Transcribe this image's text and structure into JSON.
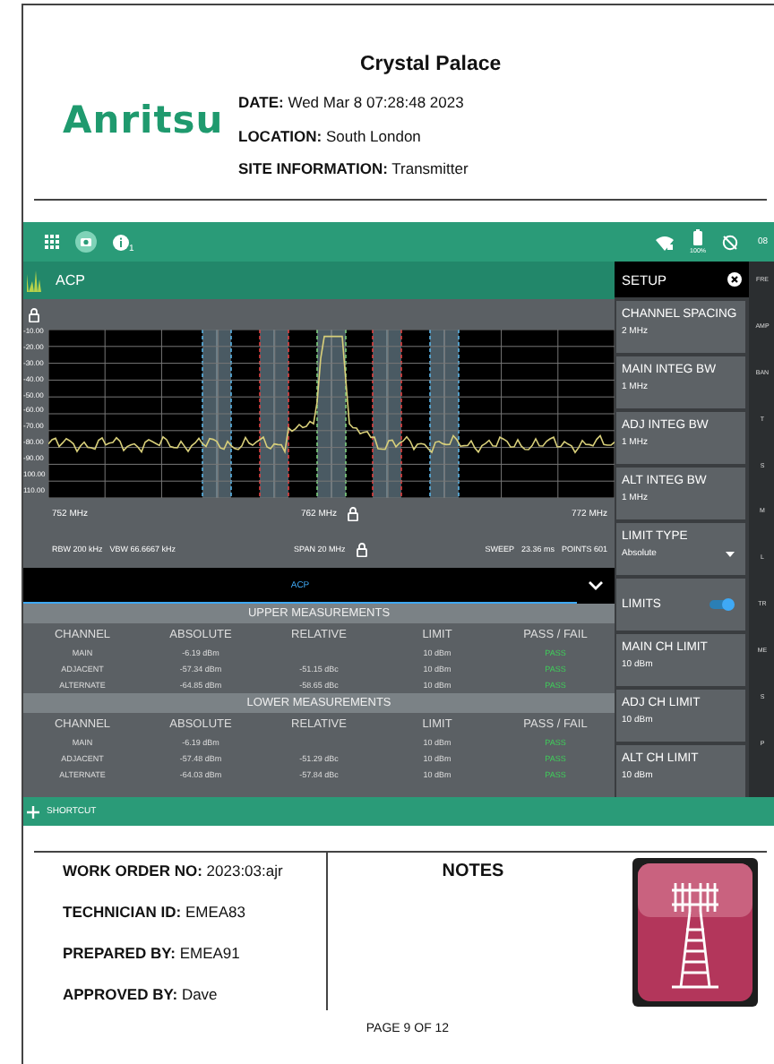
{
  "header": {
    "logo": "Anritsu",
    "title": "Crystal Palace",
    "fields": [
      "**DATE:** Wed Mar 8 07:28:48 2023",
      "**LOCATION:** South London",
      "**SITE INFORMATION:** Transmitter"
    ]
  },
  "instrument": {
    "status_bar": {
      "notification_count": "1",
      "battery": "100%",
      "clock": "08"
    },
    "app_bar": {
      "title": "ACP"
    },
    "plot": {
      "y_ticks": [
        "-10.00",
        "-20.00",
        "-30.00",
        "-40.00",
        "-50.00",
        "-60.00",
        "-70.00",
        "-80.00",
        "-90.00",
        "100.00",
        "110.00"
      ],
      "x_labels": [
        "752 MHz",
        "762 MHz",
        "772 MHz"
      ],
      "settings_left": [
        "RBW 200 kHz",
        "VBW 66.6667 kHz"
      ],
      "span": "SPAN 20 MHz",
      "sweep": "SWEEP",
      "sweep_time": "23.36 ms",
      "points": "POINTS 601"
    },
    "view_tab": "ACP",
    "sections": [
      {
        "title": "UPPER MEASUREMENTS",
        "columns": [
          "CHANNEL",
          "ABSOLUTE",
          "RELATIVE",
          "LIMIT",
          "PASS / FAIL"
        ],
        "rows": [
          [
            "MAIN",
            "-6.19 dBm",
            "",
            "10 dBm",
            "PASS"
          ],
          [
            "ADJACENT",
            "-57.34 dBm",
            "-51.15 dBc",
            "10 dBm",
            "PASS"
          ],
          [
            "ALTERNATE",
            "-64.85 dBm",
            "-58.65 dBc",
            "10 dBm",
            "PASS"
          ]
        ]
      },
      {
        "title": "LOWER MEASUREMENTS",
        "columns": [
          "CHANNEL",
          "ABSOLUTE",
          "RELATIVE",
          "LIMIT",
          "PASS / FAIL"
        ],
        "rows": [
          [
            "MAIN",
            "-6.19 dBm",
            "",
            "10 dBm",
            "PASS"
          ],
          [
            "ADJACENT",
            "-57.48 dBm",
            "-51.29 dBc",
            "10 dBm",
            "PASS"
          ],
          [
            "ALTERNATE",
            "-64.03 dBm",
            "-57.84 dBc",
            "10 dBm",
            "PASS"
          ]
        ]
      }
    ],
    "setup": {
      "title": "SETUP",
      "items": [
        {
          "kind": "value",
          "label": "CHANNEL SPACING",
          "value": "2 MHz"
        },
        {
          "kind": "value",
          "label": "MAIN INTEG BW",
          "value": "1 MHz"
        },
        {
          "kind": "value",
          "label": "ADJ INTEG BW",
          "value": "1 MHz"
        },
        {
          "kind": "value",
          "label": "ALT INTEG BW",
          "value": "1 MHz"
        },
        {
          "kind": "dropdown",
          "label": "LIMIT TYPE",
          "value": "Absolute"
        },
        {
          "kind": "toggle",
          "label": "LIMITS",
          "on": true
        },
        {
          "kind": "value",
          "label": "MAIN CH LIMIT",
          "value": "10 dBm"
        },
        {
          "kind": "value",
          "label": "ADJ CH LIMIT",
          "value": "10 dBm"
        },
        {
          "kind": "value",
          "label": "ALT CH LIMIT",
          "value": "10 dBm"
        }
      ]
    },
    "side_menu": [
      "FRE",
      "AMP",
      "BAN",
      "T",
      "S",
      "M",
      "L",
      "TR",
      "ME",
      "S",
      "P"
    ],
    "shortcut": "SHORTCUT"
  },
  "footer": {
    "fields": [
      "**WORK ORDER NO:** 2023:03:ajr",
      "**TECHNICIAN ID:** EMEA83",
      "**PREPARED BY:** EMEA91",
      "**APPROVED BY:** Dave"
    ],
    "notes_title": "NOTES",
    "page": "PAGE 9 OF 12"
  }
}
